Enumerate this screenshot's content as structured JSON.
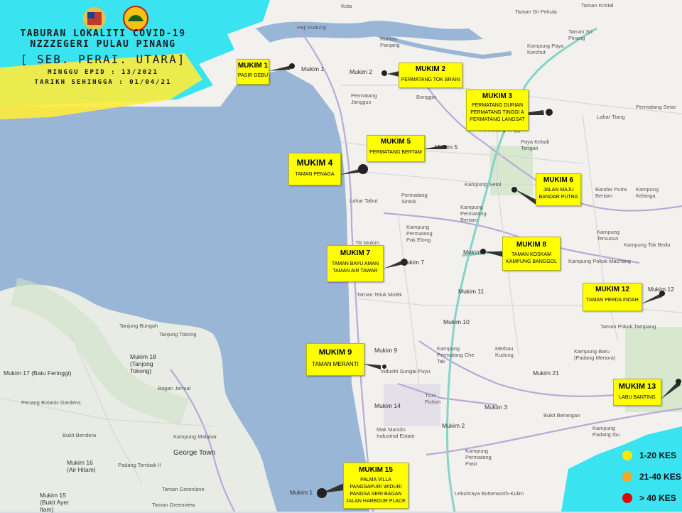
{
  "title": {
    "line1": "TABURAN LOKALITI COVID-19",
    "line2": "NZZZEGERI PULAU PINANG",
    "line3": "[ SEB. PERAI. UTARA]",
    "line4": "MINGGU EPID : 13/2021",
    "line5": "TARIKH SEHINGGA : 01/04/21"
  },
  "callouts": [
    {
      "title": "MUKIM 1",
      "lines": [
        "PASIR GEBU"
      ]
    },
    {
      "title": "MUKIM 2",
      "lines": [
        "PERMATANG TOK BRAIN"
      ]
    },
    {
      "title": "MUKIM 3",
      "lines": [
        "PERMATANG DURIAN",
        "PERMATANG TINGGI A",
        "PERMATANG LANGSAT"
      ]
    },
    {
      "title": "MUKIM 4",
      "lines": [
        "TAMAN PENAGA"
      ]
    },
    {
      "title": "MUKIM 5",
      "lines": [
        "PERMATANG BERTAM"
      ]
    },
    {
      "title": "MUKIM 6",
      "lines": [
        "JALAN MAJU",
        "BANDAR PUTRA"
      ]
    },
    {
      "title": "MUKIM 7",
      "lines": [
        "TAMAN BAYU AMAN",
        "TAMAN AIR TAWAR"
      ]
    },
    {
      "title": "MUKIM 8",
      "lines": [
        "TAMAN KOSKAM",
        "KAMPUNG BANGGOL"
      ]
    },
    {
      "title": "MUKIM 9",
      "lines": [
        "TAMAN MERANTI"
      ]
    },
    {
      "title": "MUKIM 12",
      "lines": [
        "TAMAN PERDA INDAH"
      ]
    },
    {
      "title": "MUKIM 13",
      "lines": [
        "LABU BANTING"
      ]
    },
    {
      "title": "MUKIM 15",
      "lines": [
        "PALMA VILLA",
        "PANGSAPURI WIDURI",
        "PANGSA SERI BAGAN",
        "JALAN HARBOUR PLACE"
      ]
    }
  ],
  "places": [
    "Kota",
    "Taman Sri Pekula",
    "Taman Kristal",
    "Haji Kudung",
    "Rantau Panjang",
    "Kampung Paya Kerchut",
    "Taman Sri Pinang",
    "Mukim 1",
    "Mukim 2",
    "Bonggor",
    "Permatang Janggus",
    "Permatang Tinggi A",
    "Paya Keladi Tengah",
    "Lahar Tiang",
    "Permatang Setar",
    "Mukim 5",
    "Lahar Tabut",
    "Permatang Sintok",
    "Kampung Setol",
    "Kampung Permatang Bertam",
    "Bandar Putra Bertam",
    "Kampung Kelanga",
    "Titi Mukim",
    "Kampung Permatang Pak Elong",
    "Mukim 7",
    "Mukim",
    "Kampung Tersusun",
    "Kampung Tok Bedu",
    "Kampung Pokok Machang",
    "Taman Teluk Molek",
    "Mukim 11",
    "Mukim 10",
    "Taman Pokok Tampang",
    "Mukim 12",
    "Kampung Permatang Che Tak",
    "Merbau Kudung",
    "Kampung Baru (Padang Menora)",
    "Mukim 9",
    "Industri Sungai Puyu",
    "Mukim 21",
    "Mukim 14",
    "TCH Fiction",
    "Mukim 3",
    "Bukit Berangan",
    "Mukim 2",
    "Kampung Padang Ibu",
    "Mak Mandin Industrial Estate",
    "Kampung Permatang Pasir",
    "Mukim 1",
    "Tanjung Bungah",
    "Tanjung Tokong",
    "Mukim 18 (Tanjong Tokong)",
    "Mukim 17 (Batu Feringgi)",
    "Bagan Jermal",
    "Penang Botanic Gardens",
    "Bukit Bendera",
    "Kampung Malabar",
    "George Town",
    "Mukim 16 (Air Hitam)",
    "Padang Tembak II",
    "Taman Greenlane",
    "Mukim 15 (Bukit Ayer Itam)",
    "Taman Greenview",
    "Lebuhraya Butterworth-Kulim"
  ],
  "legend": [
    {
      "label": "1-20 KES",
      "color": "#ffe800"
    },
    {
      "label": "21-40 KES",
      "color": "#f5a623"
    },
    {
      "label": "> 40 KES",
      "color": "#e50000"
    }
  ],
  "colors": {
    "sea": "#9ab6d6",
    "land": "#f2f1ee",
    "road_major": "#b9a9d8",
    "callout": "#ffff00",
    "accent_cyan": "#19e0f0",
    "accent_yellow": "#ffeb3b"
  }
}
